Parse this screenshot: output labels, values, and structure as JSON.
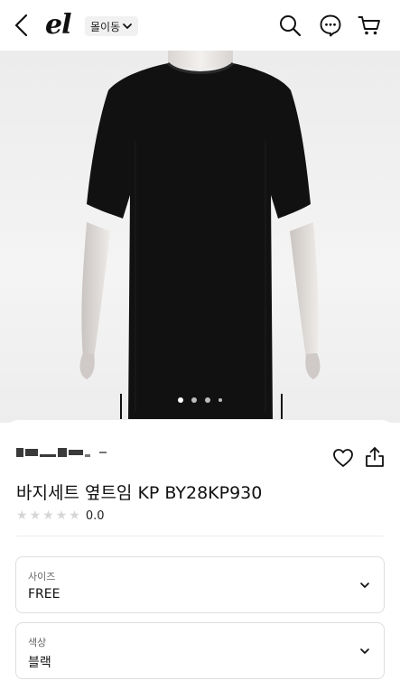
{
  "header": {
    "logo_text": "el",
    "mall_label": "몰이동",
    "icons": [
      "back-icon",
      "chevron-down-icon",
      "search-icon",
      "chat-icon",
      "cart-icon"
    ]
  },
  "hero": {
    "image_alt": "검정 반팔 니트 상의",
    "carousel_total": 4,
    "carousel_active": 1
  },
  "product": {
    "title": "바지세트 옆트임 KP BY28KP930",
    "rating_value": "0.0",
    "stars_filled": 0,
    "stars_total": 5
  },
  "options": [
    {
      "label": "사이즈",
      "value": "FREE"
    },
    {
      "label": "색상",
      "value": "블랙"
    }
  ],
  "colors": {
    "text": "#111111",
    "star_empty": "#d6d6d6",
    "border": "#dedede",
    "garment": "#111111"
  }
}
